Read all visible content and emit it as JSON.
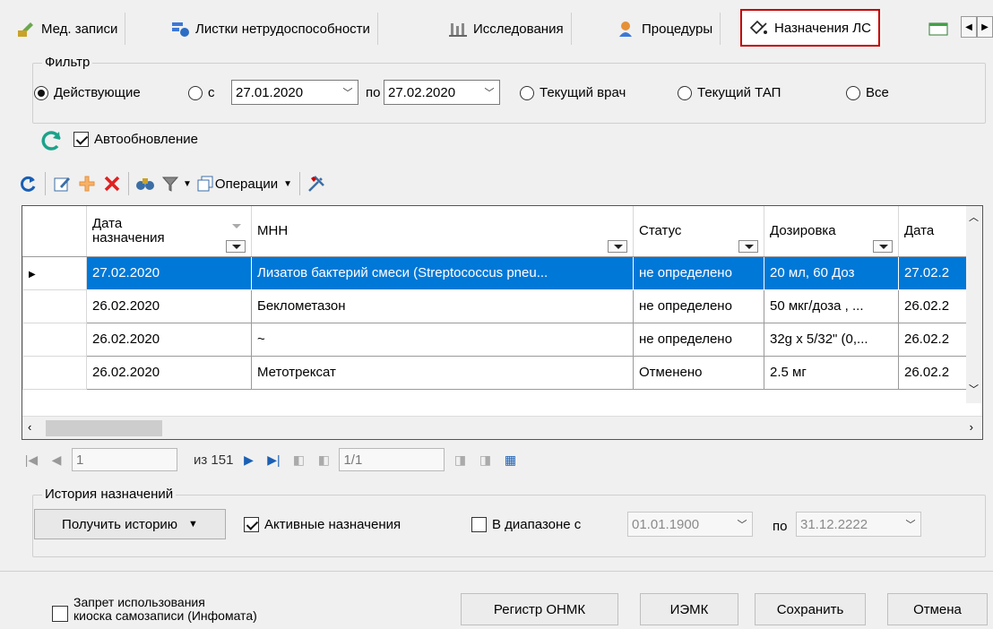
{
  "tabs": [
    {
      "label": "Мед. записи",
      "icon": "med-records-icon"
    },
    {
      "label": "Листки нетрудоспособности",
      "icon": "sick-leave-icon"
    },
    {
      "label": "Исследования",
      "icon": "research-icon"
    },
    {
      "label": "Процедуры",
      "icon": "procedures-icon"
    },
    {
      "label": "Назначения ЛС",
      "icon": "prescriptions-icon",
      "active": true
    }
  ],
  "filter": {
    "legend": "Фильтр",
    "radio_active": "Действующие",
    "radio_from": "с",
    "date_from": "27.01.2020",
    "label_to": "по",
    "date_to": "27.02.2020",
    "radio_doctor": "Текущий врач",
    "radio_tap": "Текущий ТАП",
    "radio_all": "Все",
    "selected": "Действующие"
  },
  "autorefresh": {
    "label": "Автообновление",
    "checked": true
  },
  "toolbar": {
    "operations_label": "Операции"
  },
  "grid": {
    "columns": [
      {
        "label": "Дата назначения"
      },
      {
        "label": "МНН"
      },
      {
        "label": "Статус"
      },
      {
        "label": "Дозировка"
      },
      {
        "label": "Дата"
      }
    ],
    "rows": [
      [
        "27.02.2020",
        "Лизатов бактерий смеси (Streptococcus pneu...",
        "не определено",
        "20 мл, 60 Доз",
        "27.02.2"
      ],
      [
        "26.02.2020",
        "Беклометазон",
        "не определено",
        "50 мкг/доза , ...",
        "26.02.2"
      ],
      [
        "26.02.2020",
        "~",
        "не определено",
        "32g x 5/32\" (0,...",
        "26.02.2"
      ],
      [
        "26.02.2020",
        "Метотрексат",
        "Отменено",
        "2.5 мг",
        "26.02.2"
      ]
    ],
    "selected_row": 0
  },
  "navigator": {
    "position": "1",
    "of_label": "из 151",
    "page": "1/1"
  },
  "history": {
    "legend": "История назначений",
    "get_history_label": "Получить историю",
    "active_label": "Активные назначения",
    "active_checked": true,
    "range_label": "В диапазоне с",
    "range_checked": false,
    "range_from": "01.01.1900",
    "range_to_label": "по",
    "range_to": "31.12.2222"
  },
  "footer": {
    "kiosk_label_line1": "Запрет  использования",
    "kiosk_label_line2": "киоска самозаписи (Инфомата)",
    "register_label": "Регистр ОНМК",
    "iemk_label": "ИЭМК",
    "save_label": "Сохранить",
    "cancel_label": "Отмена"
  }
}
